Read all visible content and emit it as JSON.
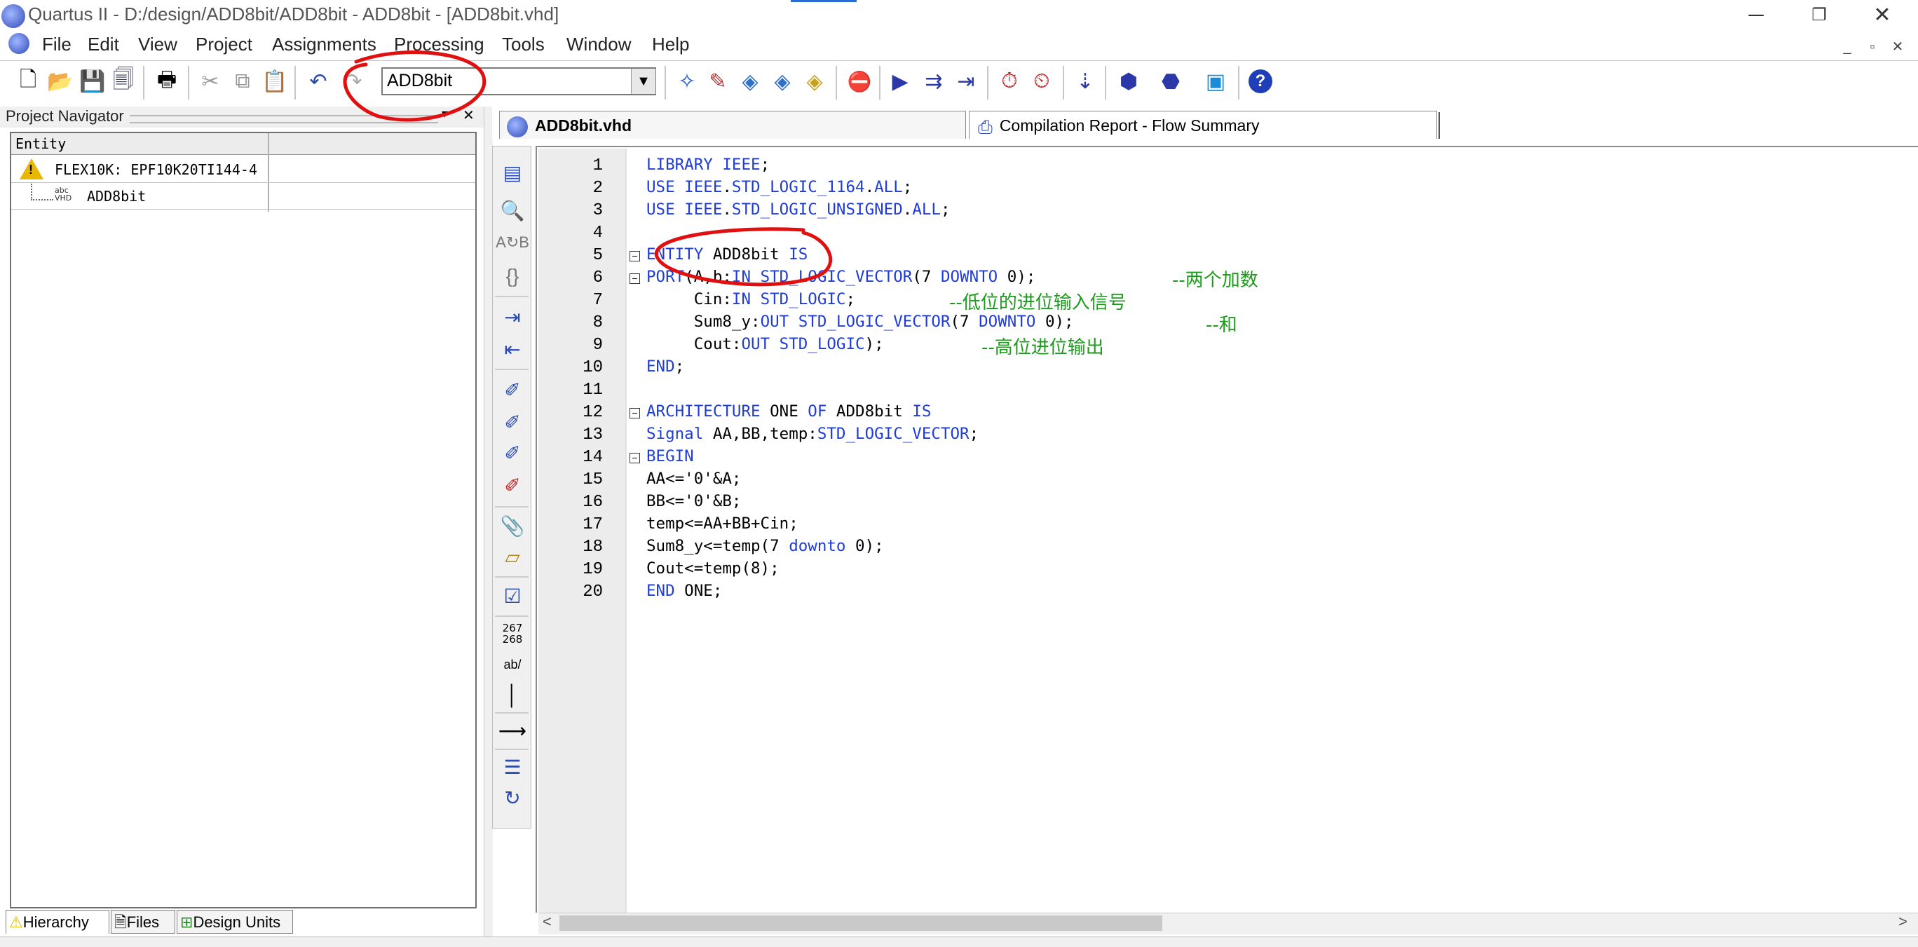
{
  "window": {
    "title": "Quartus II - D:/design/ADD8bit/ADD8bit - ADD8bit - [ADD8bit.vhd]",
    "minimize": "─",
    "restore": "❐",
    "close": "✕"
  },
  "menu": {
    "items": [
      "File",
      "Edit",
      "View",
      "Project",
      "Assignments",
      "Processing",
      "Tools",
      "Window",
      "Help"
    ],
    "mdi_minimize": "_",
    "mdi_restore": "▫",
    "mdi_close": "✕"
  },
  "toolbar": {
    "entity_combo_value": "ADD8bit",
    "combo_arrow": "▼",
    "icons": [
      "new-file-icon",
      "open-icon",
      "save-icon",
      "save-all-icon",
      "print-icon",
      "cut-icon",
      "copy-icon",
      "paste-icon",
      "undo-icon",
      "redo-icon",
      "project-navigator-icon",
      "settings-icon",
      "analysis-icon",
      "analysis-elaboration-icon",
      "analysis-synthesis-icon",
      "stop-icon",
      "start-compilation-icon",
      "start-analysis-icon",
      "start-timing-icon",
      "timing-analyzer-icon",
      "timing-wizard-icon",
      "chip-planner-icon",
      "assignment-editor-icon",
      "pin-planner-icon",
      "programmer-icon",
      "help-icon"
    ]
  },
  "navigator": {
    "title": "Project Navigator",
    "close": "✕",
    "column_entity": "Entity",
    "rows": [
      {
        "label": "FLEX10K: EPF10K20TI144-4"
      },
      {
        "label": "ADD8bit"
      }
    ],
    "vhd_icon_text": "abc VHD",
    "warn_mark": "!",
    "tabs": [
      "Hierarchy",
      "Files",
      "Design Units"
    ]
  },
  "editor": {
    "tabs": [
      {
        "label": "ADD8bit.vhd"
      },
      {
        "label": "Compilation Report - Flow Summary"
      }
    ],
    "vtool_icons": [
      "open-file-editor-icon",
      "find-icon",
      "replace-icon",
      "braces-icon",
      "indent-icon",
      "unindent-icon",
      "bookmark-toggle-icon",
      "bookmark-next-icon",
      "bookmark-prev-icon",
      "bookmark-clear-icon",
      "attach-icon",
      "template-icon",
      "check-icon",
      "line-numbers-icon",
      "case-icon",
      "cursor-icon",
      "wrap-icon",
      "comment-icon",
      "uncomment-icon"
    ],
    "line_numbers_icon_text": "267 268",
    "case_icon_text": "ab/",
    "lines": [
      {
        "n": "1",
        "code": "LIBRARY IEEE;"
      },
      {
        "n": "2",
        "code": "USE IEEE.STD_LOGIC_1164.ALL;"
      },
      {
        "n": "3",
        "code": "USE IEEE.STD_LOGIC_UNSIGNED.ALL;"
      },
      {
        "n": "4",
        "code": ""
      },
      {
        "n": "5",
        "code": "ENTITY ADD8bit IS"
      },
      {
        "n": "6",
        "code": "PORT(A,b:IN STD_LOGIC_VECTOR(7 DOWNTO 0);",
        "comment": "--两个加数"
      },
      {
        "n": "7",
        "code": "     Cin:IN STD_LOGIC;",
        "comment": "--低位的进位输入信号"
      },
      {
        "n": "8",
        "code": "     Sum8_y:OUT STD_LOGIC_VECTOR(7 DOWNTO 0);",
        "comment": "--和"
      },
      {
        "n": "9",
        "code": "     Cout:OUT STD_LOGIC);",
        "comment": "--高位进位输出"
      },
      {
        "n": "10",
        "code": "END;"
      },
      {
        "n": "11",
        "code": ""
      },
      {
        "n": "12",
        "code": "ARCHITECTURE ONE OF ADD8bit IS"
      },
      {
        "n": "13",
        "code": "Signal AA,BB,temp:STD_LOGIC_VECTOR;"
      },
      {
        "n": "14",
        "code": "BEGIN"
      },
      {
        "n": "15",
        "code": "AA<='0'&A;"
      },
      {
        "n": "16",
        "code": "BB<='0'&B;"
      },
      {
        "n": "17",
        "code": "temp<=AA+BB+Cin;"
      },
      {
        "n": "18",
        "code": "Sum8_y<=temp(7 downto 0);"
      },
      {
        "n": "19",
        "code": "Cout<=temp(8);"
      },
      {
        "n": "20",
        "code": "END ONE;"
      }
    ],
    "fold_marker": "−",
    "scroll_left": "<",
    "scroll_right": ">"
  },
  "colors": {
    "keyword": "#1f3dd6",
    "comment": "#1d9b1d",
    "annotation": "#e01010"
  }
}
